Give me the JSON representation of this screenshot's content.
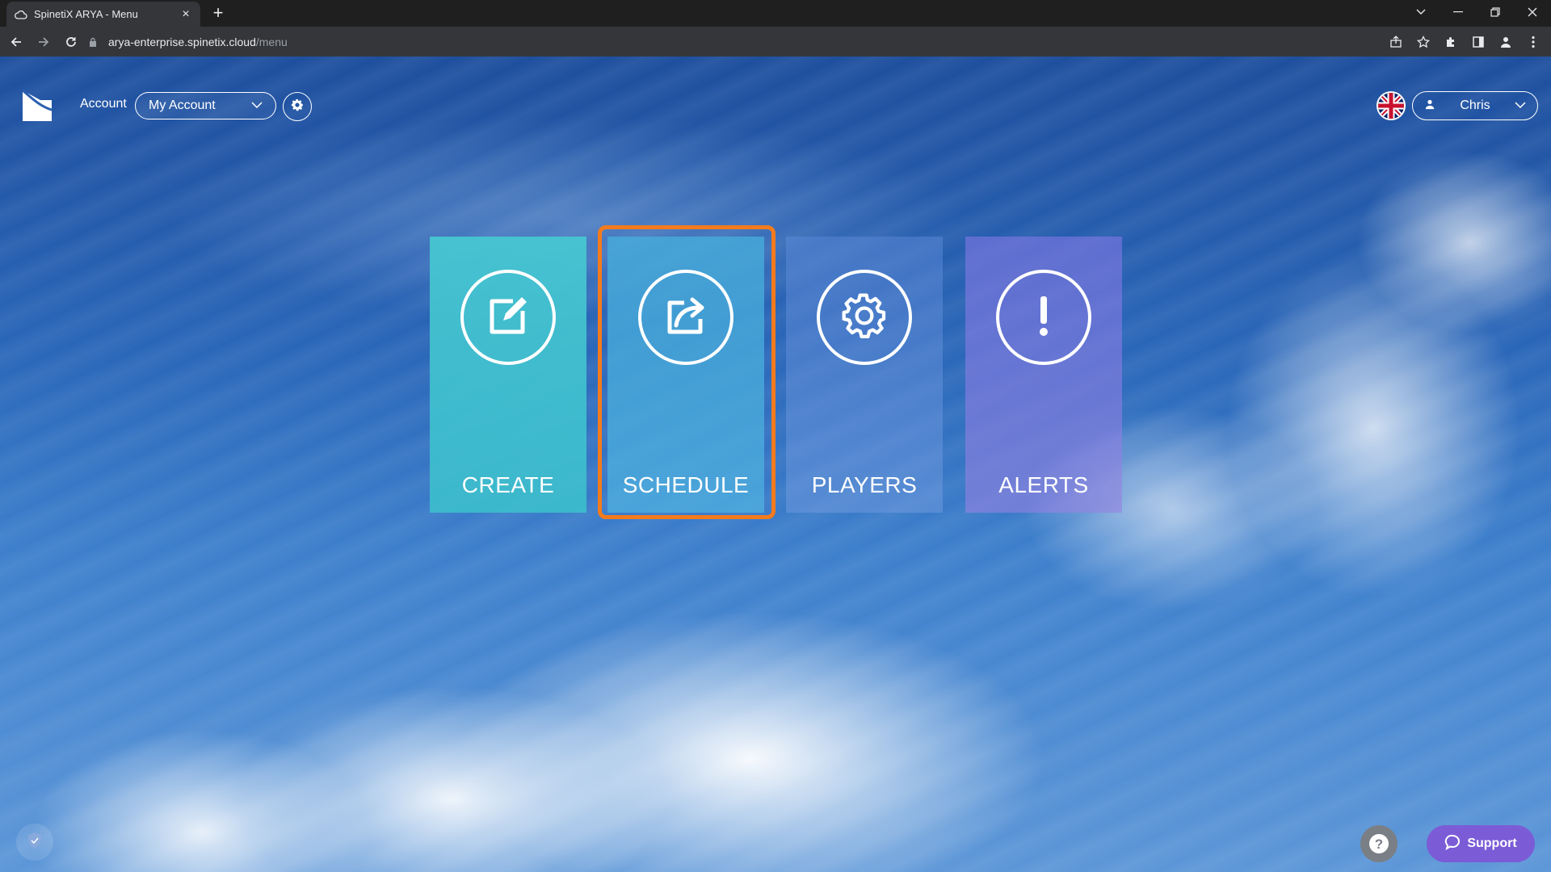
{
  "browser": {
    "tab_title": "SpinetiX ARYA - Menu",
    "tab_close": "×",
    "new_tab": "+",
    "url_host": "arya-enterprise.spinetix.cloud",
    "url_path": "/menu"
  },
  "header": {
    "account_label": "Account",
    "account_value": "My Account",
    "user_name": "Chris"
  },
  "tiles": [
    {
      "label": "CREATE",
      "icon": "edit-icon"
    },
    {
      "label": "SCHEDULE",
      "icon": "share-icon"
    },
    {
      "label": "PLAYERS",
      "icon": "gear-icon"
    },
    {
      "label": "ALERTS",
      "icon": "exclamation-icon"
    }
  ],
  "footer": {
    "help_label": "?",
    "support_label": "Support"
  },
  "colors": {
    "highlight": "#f37b1d",
    "support": "#7b5cd6"
  }
}
